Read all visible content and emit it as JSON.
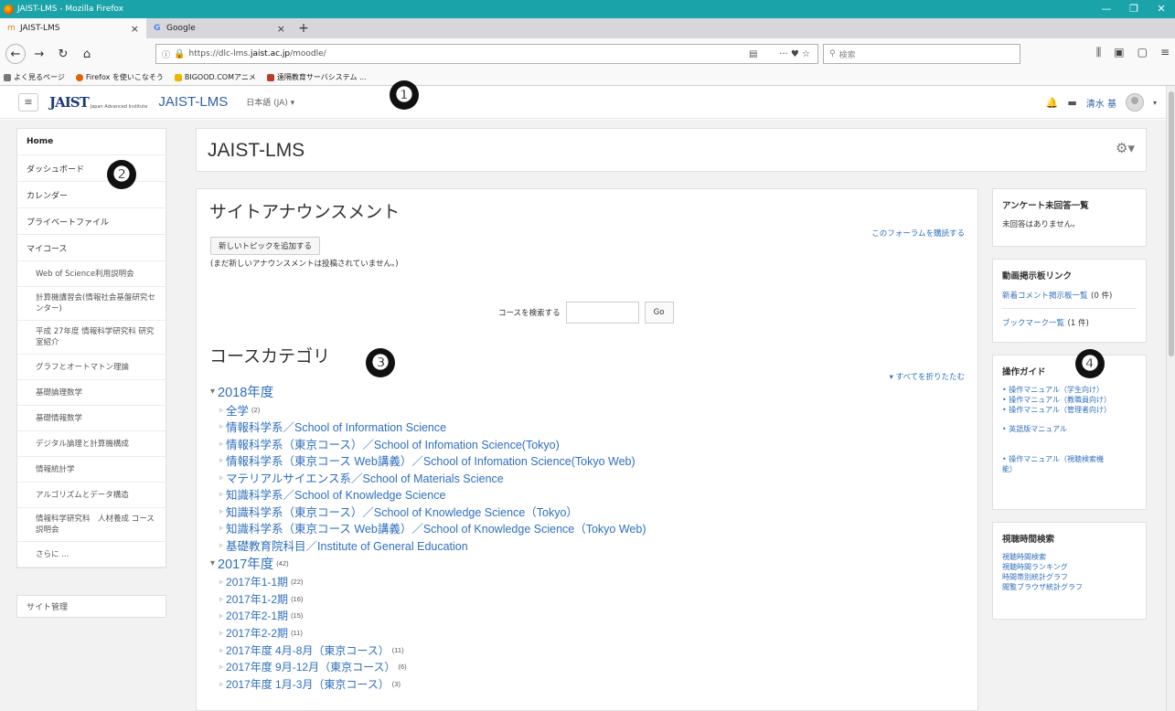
{
  "browser": {
    "window_title": "JAIST-LMS - Mozilla Firefox",
    "tabs": [
      {
        "label": "JAIST-LMS",
        "close": "×"
      },
      {
        "label": "Google",
        "close": "×"
      }
    ],
    "new_tab": "+",
    "url_prefix": "https://dlc-lms.",
    "url_host": "jaist.ac.jp",
    "url_suffix": "/moodle/",
    "url_actions": "··· ♥ ☆",
    "search_placeholder": "検索",
    "bookmarks": [
      {
        "label": "よく見るページ",
        "color": "#777777"
      },
      {
        "label": "Firefox を使いこなそう",
        "color": "#e66000"
      },
      {
        "label": "BIGOOD.COMアニメ",
        "color": "#f0b400"
      },
      {
        "label": "遠隔教育サーバシステム ...",
        "color": "#c0392b"
      }
    ],
    "window_controls": [
      "—",
      "❐",
      "✕"
    ]
  },
  "moodle": {
    "menu_icon": "≡",
    "logo_text": "JAIST",
    "logo_sub": "Japan Advanced Institute",
    "site_name": "JAIST-LMS",
    "language": "日本語 (JA) ▾",
    "user_name": "清水 基",
    "user_caret": "▾"
  },
  "callouts": [
    "❶",
    "❷",
    "❸",
    "❹"
  ],
  "left_nav": {
    "items": [
      {
        "label": "Home",
        "type": "home"
      },
      {
        "label": "ダッシュボード",
        "type": "top"
      },
      {
        "label": "カレンダー",
        "type": "top"
      },
      {
        "label": "プライベートファイル",
        "type": "top"
      },
      {
        "label": "マイコース",
        "type": "top"
      },
      {
        "label": "Web of Science利用説明会",
        "type": "sub"
      },
      {
        "label": "計算機講習会(情報社会基盤研究センター)",
        "type": "sub"
      },
      {
        "label": "平成 27年度 情報科学研究科 研究室紹介",
        "type": "sub"
      },
      {
        "label": "グラフとオートマトン理論",
        "type": "sub"
      },
      {
        "label": "基礎論理数学",
        "type": "sub"
      },
      {
        "label": "基礎情報数学",
        "type": "sub"
      },
      {
        "label": "デジタル論理と計算機構成",
        "type": "sub"
      },
      {
        "label": "情報統計学",
        "type": "sub"
      },
      {
        "label": "アルゴリズムとデータ構造",
        "type": "sub"
      },
      {
        "label": "情報科学研究科　人材養成 コース説明会",
        "type": "sub"
      },
      {
        "label": "さらに ...",
        "type": "sub"
      }
    ],
    "admin": "サイト管理"
  },
  "page": {
    "title": "JAIST-LMS",
    "announcements_title": "サイトアナウンスメント",
    "subscribe_link": "このフォーラムを購読する",
    "add_topic_button": "新しいトピックを追加する",
    "no_news": "(まだ新しいアナウンスメントは投稿されていません。)",
    "course_search_label": "コースを検索する",
    "course_search_value": "",
    "go_button": "Go",
    "categories_title": "コースカテゴリ",
    "collapse_all": "▾ すべてを折りたたむ",
    "categories": [
      {
        "label": "2018年度",
        "count": "",
        "kind": "year",
        "arrow": "▾"
      },
      {
        "label": "全学",
        "count": "(2)",
        "kind": "sub",
        "arrow": "▹"
      },
      {
        "label": "情報科学系／School of Information Science",
        "count": "",
        "kind": "sub",
        "arrow": "▹"
      },
      {
        "label": "情報科学系（東京コース）／School of Infomation Science(Tokyo)",
        "count": "",
        "kind": "sub",
        "arrow": "▹"
      },
      {
        "label": "情報科学系（東京コース Web講義）／School of Infomation Science(Tokyo Web)",
        "count": "",
        "kind": "sub",
        "arrow": "▹"
      },
      {
        "label": "マテリアルサイエンス系／School of Materials Science",
        "count": "",
        "kind": "sub",
        "arrow": "▹"
      },
      {
        "label": "知識科学系／School of Knowledge Science",
        "count": "",
        "kind": "sub",
        "arrow": "▹"
      },
      {
        "label": "知識科学系（東京コース）／School of Knowledge Science（Tokyo）",
        "count": "",
        "kind": "sub",
        "arrow": "▹"
      },
      {
        "label": "知識科学系（東京コース Web講義）／School of Knowledge Science（Tokyo Web)",
        "count": "",
        "kind": "sub",
        "arrow": "▹"
      },
      {
        "label": "基礎教育院科目／Institute of General Education",
        "count": "",
        "kind": "sub",
        "arrow": "▹"
      },
      {
        "label": "2017年度",
        "count": "(42)",
        "kind": "year",
        "arrow": "▾"
      },
      {
        "label": "2017年1-1期",
        "count": "(22)",
        "kind": "sub2",
        "arrow": "▹"
      },
      {
        "label": "2017年1-2期",
        "count": "(16)",
        "kind": "sub2",
        "arrow": "▹"
      },
      {
        "label": "2017年2-1期",
        "count": "(15)",
        "kind": "sub2",
        "arrow": "▹"
      },
      {
        "label": "2017年2-2期",
        "count": "(11)",
        "kind": "sub2",
        "arrow": "▹"
      },
      {
        "label": "2017年度 4月-8月（東京コース）",
        "count": "(11)",
        "kind": "sub2",
        "arrow": "▹"
      },
      {
        "label": "2017年度 9月-12月（東京コース）",
        "count": "(6)",
        "kind": "sub2",
        "arrow": "▹"
      },
      {
        "label": "2017年度 1月-3月（東京コース）",
        "count": "(3)",
        "kind": "sub2",
        "arrow": "▹"
      }
    ]
  },
  "right_blocks": {
    "survey": {
      "title": "アンケート未回答一覧",
      "text": "未回答はありません。"
    },
    "video_board": {
      "title": "動画掲示板リンク",
      "link1": "新着コメント掲示板一覧",
      "count1": "(0 件)",
      "link2": "ブックマーク一覧",
      "count2": "(1 件)"
    },
    "guide": {
      "title": "操作ガイド",
      "items": [
        "• 操作マニュアル（学生向け）",
        "• 操作マニュアル（教職員向け）",
        "• 操作マニュアル（管理者向け）",
        "• 英語版マニュアル",
        "• 操作マニュアル（視聴検索機能）"
      ]
    },
    "viewing_time": {
      "title": "視聴時間検索",
      "items": [
        "視聴時間検索",
        "視聴時間ランキング",
        "時間帯別統計グラフ",
        "閲覧ブラウザ統計グラフ"
      ]
    }
  }
}
